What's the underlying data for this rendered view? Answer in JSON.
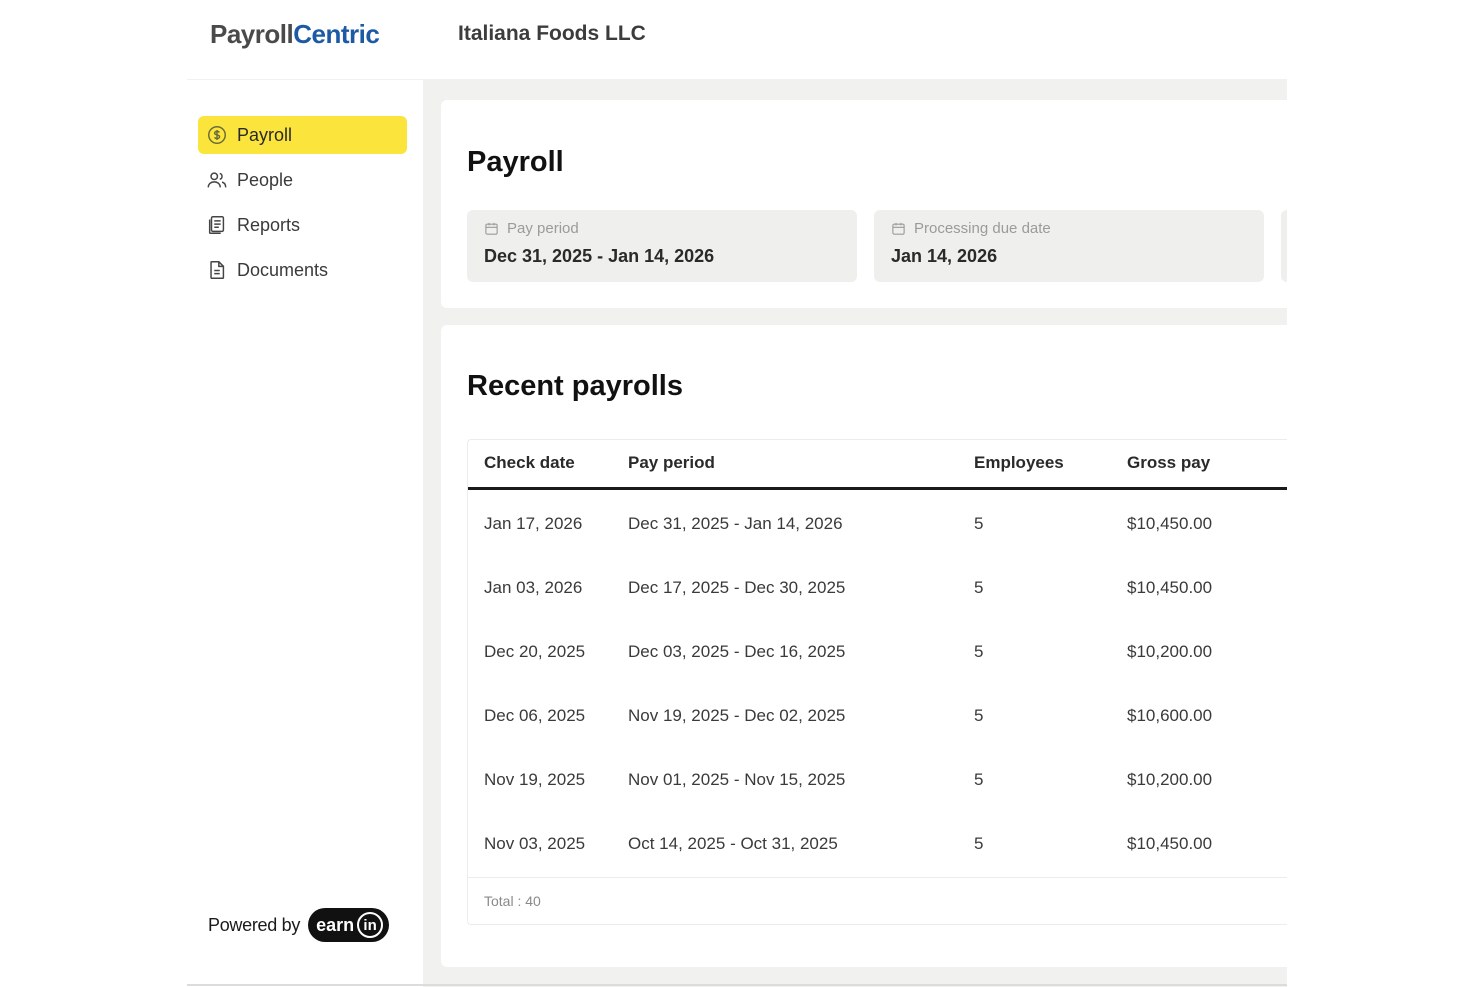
{
  "header": {
    "logo_part1": "Payroll",
    "logo_part2": "Centric",
    "company": "Italiana Foods LLC"
  },
  "sidebar": {
    "items": [
      {
        "label": "Payroll",
        "icon": "dollar-circle-icon",
        "active": true
      },
      {
        "label": "People",
        "icon": "people-icon",
        "active": false
      },
      {
        "label": "Reports",
        "icon": "reports-icon",
        "active": false
      },
      {
        "label": "Documents",
        "icon": "document-icon",
        "active": false
      }
    ],
    "powered_by": "Powered by",
    "brand_earn": "earn",
    "brand_in": "in"
  },
  "payroll": {
    "title": "Payroll",
    "pay_period_label": "Pay period",
    "pay_period_value": "Dec 31, 2025 - Jan 14, 2026",
    "due_label": "Processing due date",
    "due_value": "Jan 14, 2026"
  },
  "recent": {
    "title": "Recent payrolls",
    "columns": [
      "Check date",
      "Pay period",
      "Employees",
      "Gross pay"
    ],
    "rows": [
      [
        "Jan 17, 2026",
        "Dec 31, 2025 - Jan 14, 2026",
        "5",
        "$10,450.00"
      ],
      [
        "Jan 03, 2026",
        "Dec 17, 2025 - Dec 30, 2025",
        "5",
        "$10,450.00"
      ],
      [
        "Dec 20, 2025",
        "Dec 03, 2025 - Dec 16, 2025",
        "5",
        "$10,200.00"
      ],
      [
        "Dec 06, 2025",
        "Nov 19, 2025 - Dec 02, 2025",
        "5",
        "$10,600.00"
      ],
      [
        "Nov 19, 2025",
        "Nov 01, 2025 - Nov 15, 2025",
        "5",
        "$10,200.00"
      ],
      [
        "Nov 03, 2025",
        "Oct 14, 2025 - Oct 31, 2025",
        "5",
        "$10,450.00"
      ]
    ],
    "total": "Total : 40"
  },
  "colors": {
    "accent": "#fbe43b",
    "brand_blue": "#1d5aa6",
    "background": "#f1f1ef"
  }
}
